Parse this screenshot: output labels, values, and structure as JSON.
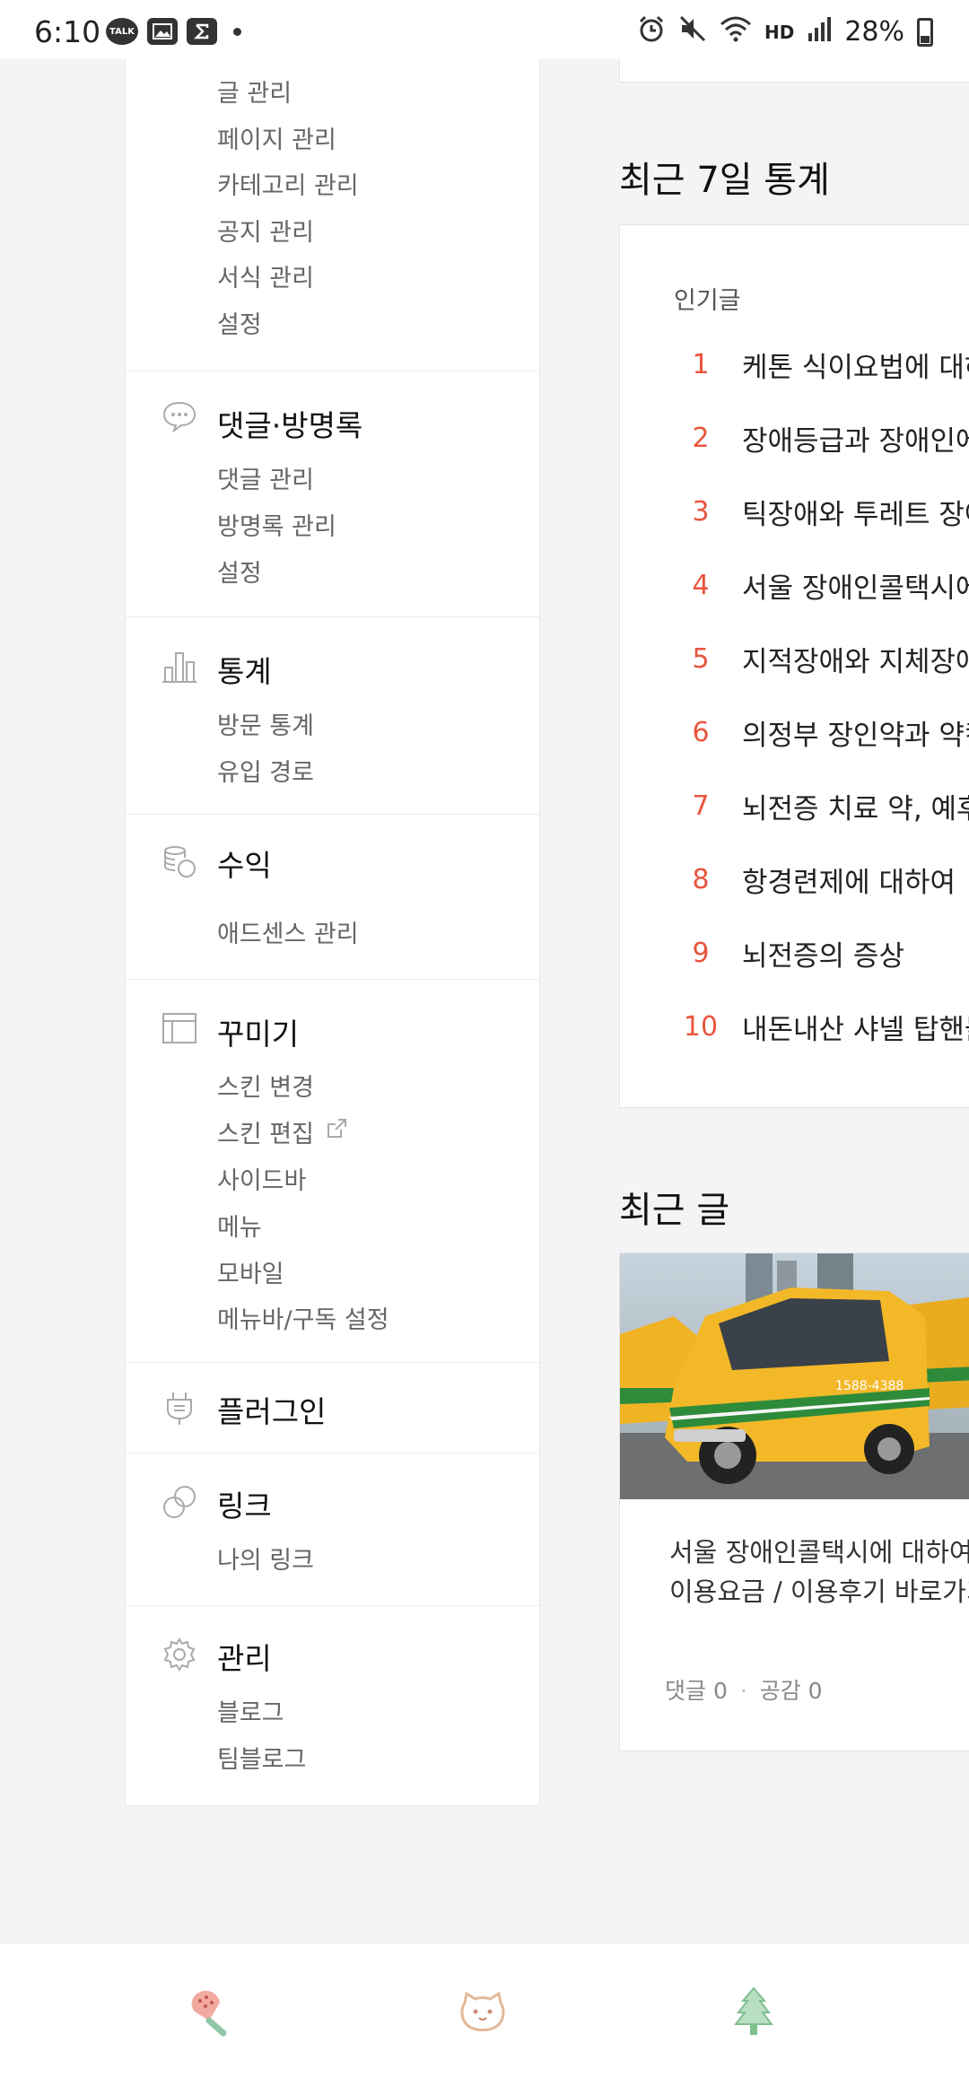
{
  "status_bar": {
    "time": "6:10",
    "battery": "28%",
    "left_icons": [
      "talk-icon",
      "image-icon",
      "sigma-icon",
      "dot-icon"
    ],
    "right_icons": [
      "alarm-icon",
      "mute-icon",
      "wifi-icon",
      "hd-voice-icon",
      "signal-icon",
      "battery-icon"
    ],
    "talk_label": "TALK",
    "hd_label": "HD"
  },
  "menu": {
    "content_items": [
      "글 관리",
      "페이지 관리",
      "카테고리 관리",
      "공지 관리",
      "서식 관리",
      "설정"
    ],
    "comments": {
      "title": "댓글·방명록",
      "items": [
        "댓글 관리",
        "방명록 관리",
        "설정"
      ]
    },
    "stats": {
      "title": "통계",
      "items": [
        "방문 통계",
        "유입 경로"
      ]
    },
    "revenue": {
      "title": "수익",
      "items": [
        "애드센스 관리"
      ]
    },
    "decorate": {
      "title": "꾸미기",
      "items": [
        "스킨 변경",
        "스킨 편집",
        "사이드바",
        "메뉴",
        "모바일",
        "메뉴바/구독 설정"
      ]
    },
    "plugins": {
      "title": "플러그인"
    },
    "links": {
      "title": "링크",
      "items": [
        "나의 링크"
      ]
    },
    "manage": {
      "title": "관리",
      "items": [
        "블로그",
        "팀블로그"
      ]
    }
  },
  "stats_section": {
    "heading": "최근 7일 통계",
    "subheading": "인기글",
    "popular_posts": [
      {
        "rank": "1",
        "title": "케톤 식이요법에 대하"
      },
      {
        "rank": "2",
        "title": "장애등급과 장애인에"
      },
      {
        "rank": "3",
        "title": "틱장애와 투레트 장아"
      },
      {
        "rank": "4",
        "title": "서울 장애인콜택시에"
      },
      {
        "rank": "5",
        "title": "지적장애와 지체장애"
      },
      {
        "rank": "6",
        "title": "의정부 장인약과 약컷"
      },
      {
        "rank": "7",
        "title": "뇌전증 치료 약, 예후이"
      },
      {
        "rank": "8",
        "title": "항경련제에 대하여"
      },
      {
        "rank": "9",
        "title": "뇌전증의 증상"
      },
      {
        "rank": "10",
        "title": "내돈내산 샤넬 탑핸들"
      }
    ]
  },
  "recent_section": {
    "heading": "최근 글",
    "post": {
      "title_line1": "서울 장애인콜택시에 대하여",
      "title_line2": "이용요금 / 이용후기 바로가기",
      "comments": "댓글 0",
      "likes": "공감 0",
      "separator": "·",
      "taxi_phone": "1588-4388"
    }
  },
  "bottom_nav": [
    "popsicle-icon",
    "bear-face-icon",
    "tree-icon"
  ],
  "colors": {
    "accent_rank": "#e8553e",
    "background": "#f4f4f6",
    "taxi_yellow": "#f0b323",
    "taxi_green": "#2e8b3a"
  }
}
